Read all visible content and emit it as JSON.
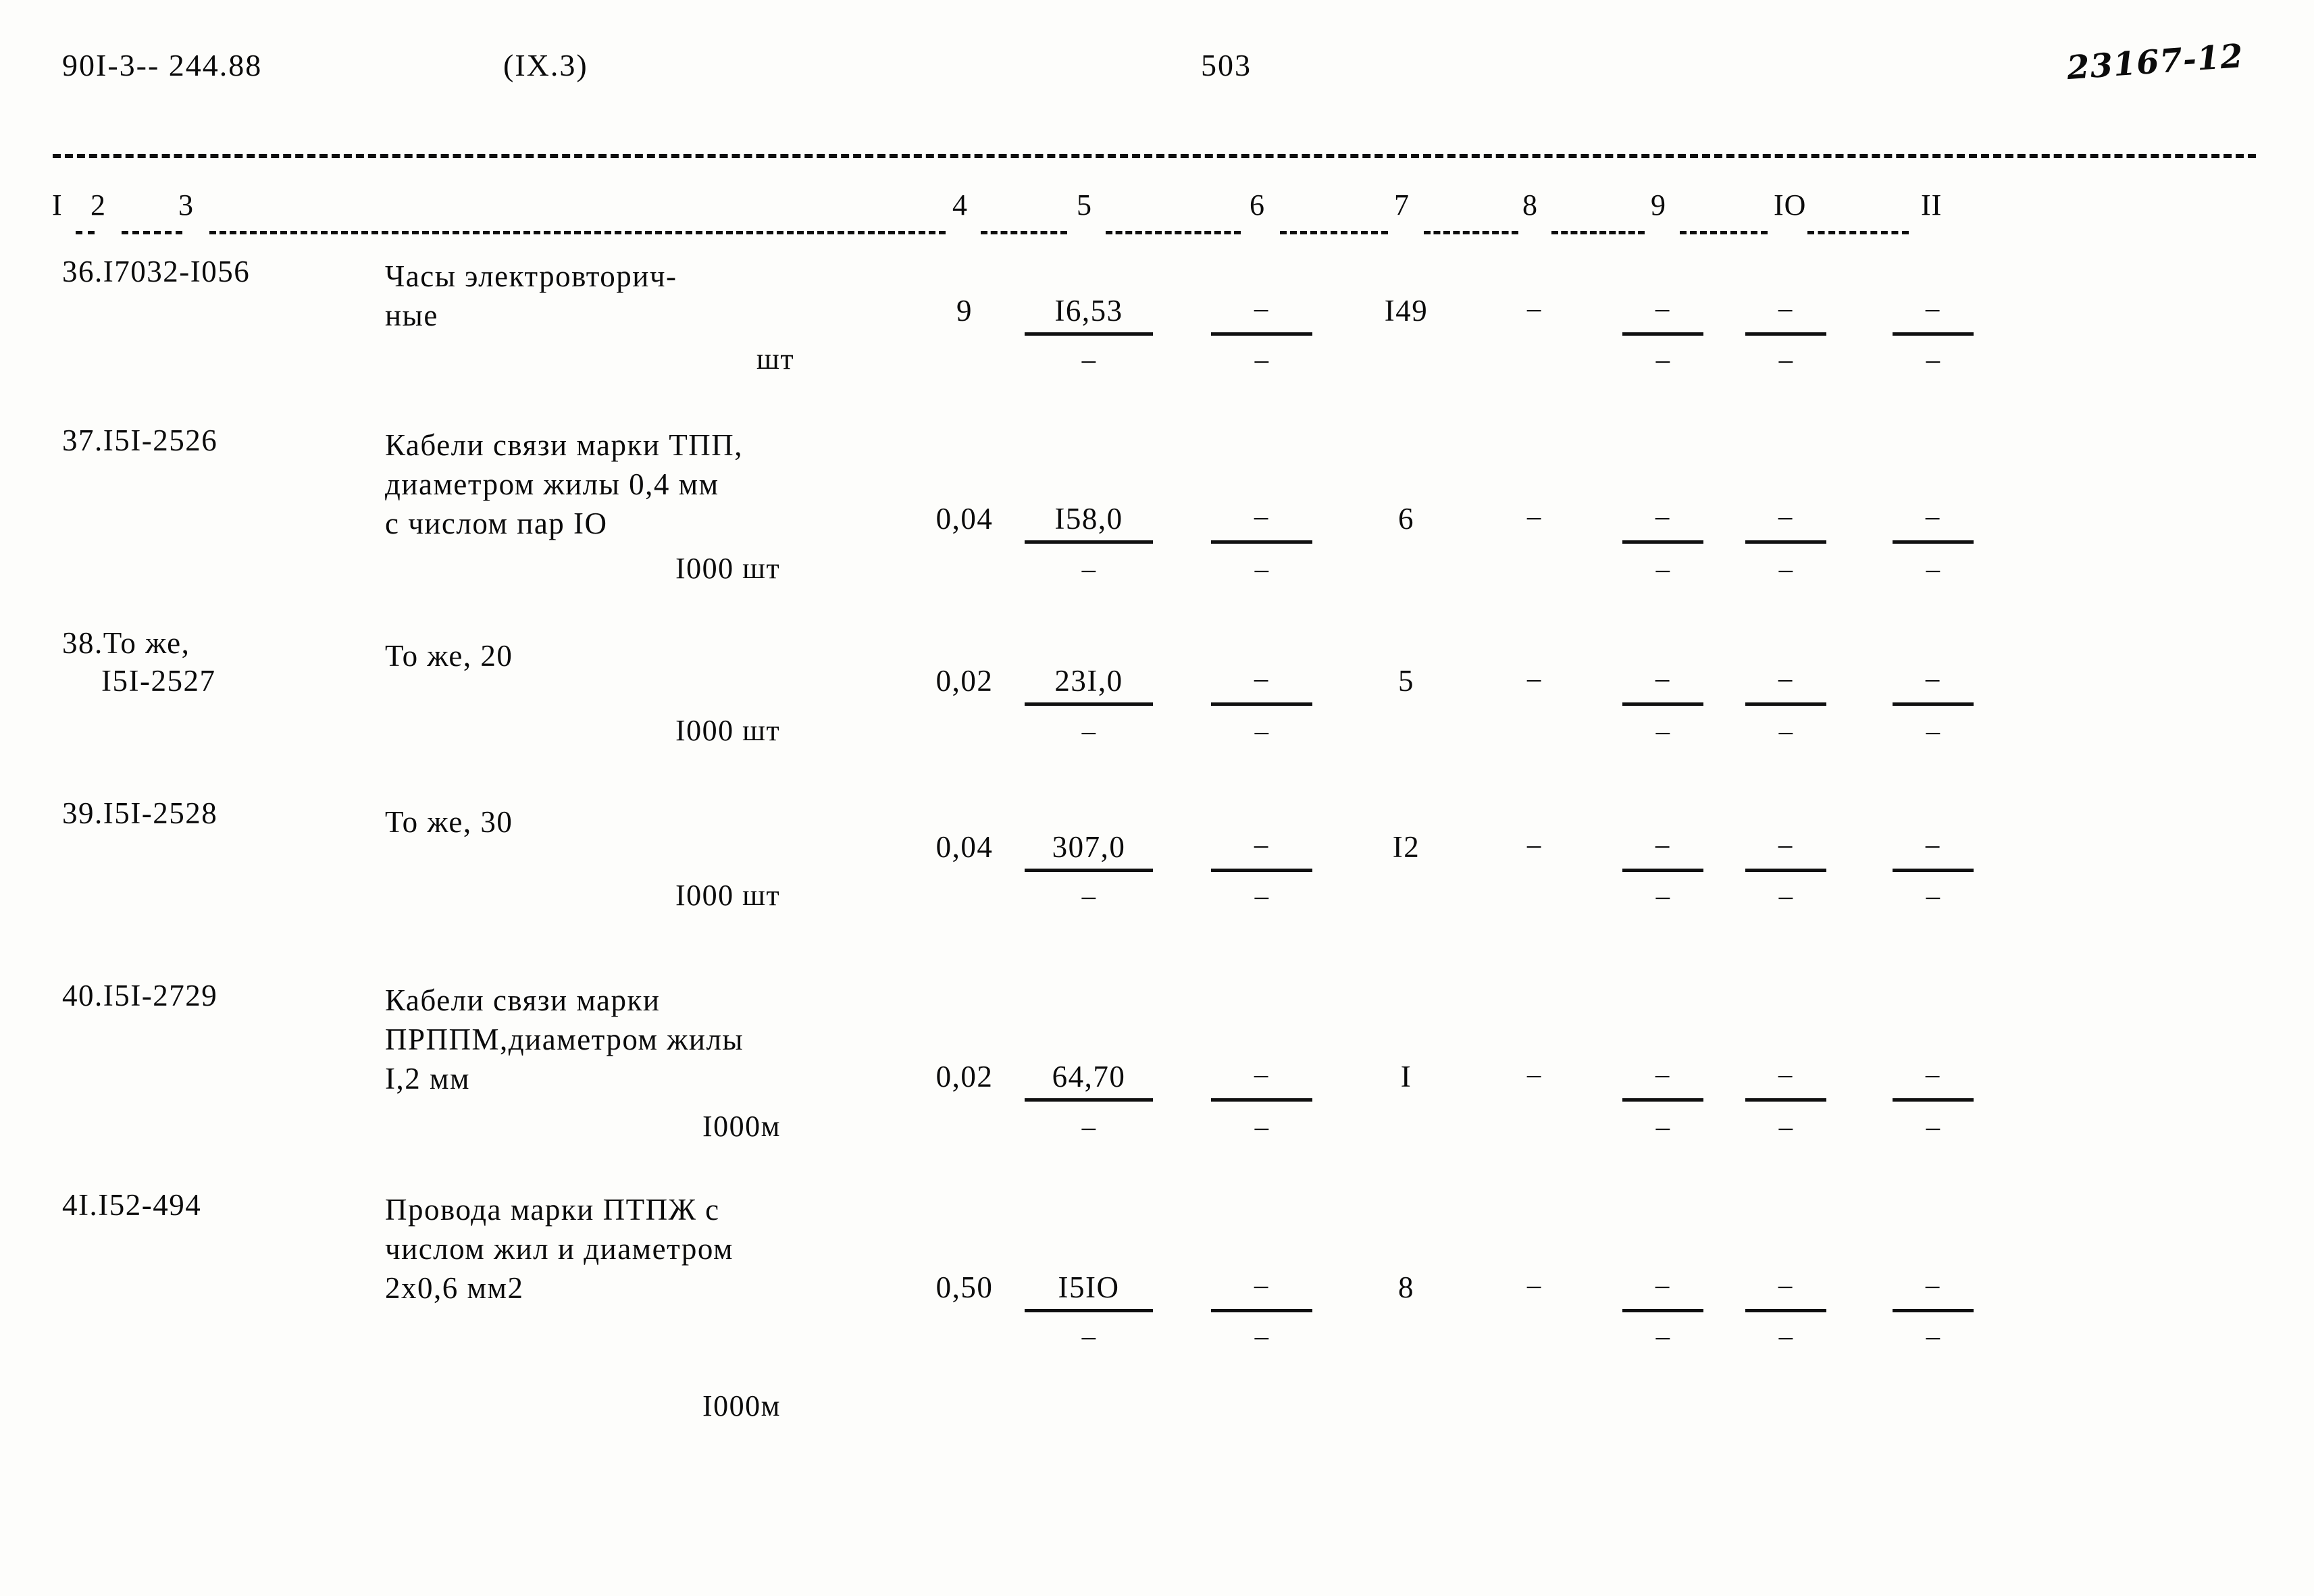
{
  "header": {
    "doc_code": "90I-3-- 244.88",
    "section": "(IX.3)",
    "page_number": "503",
    "hand_note": "23167-12"
  },
  "table": {
    "column_headers": [
      "I",
      "2",
      "3",
      "4",
      "5",
      "6",
      "7",
      "8",
      "9",
      "IO",
      "II"
    ],
    "rows": [
      {
        "code": "36.I7032-I056",
        "code2": "",
        "desc": "Часы электровторич-\nные",
        "unit": "шт",
        "c4": "9",
        "c5": "I6,53",
        "c6": "−",
        "c7": "I49",
        "c8": "−",
        "c9": "−",
        "c10": "−",
        "c11": "−",
        "s5": "−",
        "s6": "−",
        "s9": "−",
        "s10": "−",
        "s11": "−"
      },
      {
        "code": "37.I5I-2526",
        "code2": "",
        "desc": "Кабели связи марки ТПП,\nдиаметром жилы 0,4 мм\nс числом пар IO",
        "unit": "I000 шт",
        "c4": "0,04",
        "c5": "I58,0",
        "c6": "−",
        "c7": "6",
        "c8": "−",
        "c9": "−",
        "c10": "−",
        "c11": "−",
        "s5": "−",
        "s6": "−",
        "s9": "−",
        "s10": "−",
        "s11": "−"
      },
      {
        "code": "38.То же,",
        "code2": "I5I-2527",
        "desc": "То же, 20",
        "unit": "I000 шт",
        "c4": "0,02",
        "c5": "23I,0",
        "c6": "−",
        "c7": "5",
        "c8": "−",
        "c9": "−",
        "c10": "−",
        "c11": "−",
        "s5": "−",
        "s6": "−",
        "s9": "−",
        "s10": "−",
        "s11": "−"
      },
      {
        "code": "39.I5I-2528",
        "code2": "",
        "desc": "То же, 30",
        "unit": "I000 шт",
        "c4": "0,04",
        "c5": "307,0",
        "c6": "−",
        "c7": "I2",
        "c8": "−",
        "c9": "−",
        "c10": "−",
        "c11": "−",
        "s5": "−",
        "s6": "−",
        "s9": "−",
        "s10": "−",
        "s11": "−"
      },
      {
        "code": "40.I5I-2729",
        "code2": "",
        "desc": "Кабели связи марки\nПРППМ,диаметром жилы\nI,2 мм",
        "unit": "I000м",
        "c4": "0,02",
        "c5": "64,70",
        "c6": "−",
        "c7": "I",
        "c8": "−",
        "c9": "−",
        "c10": "−",
        "c11": "−",
        "s5": "−",
        "s6": "−",
        "s9": "−",
        "s10": "−",
        "s11": "−"
      },
      {
        "code": "4I.I52-494",
        "code2": "",
        "desc": "Провода марки ПТПЖ с\nчислом жил и диаметром\n2х0,6 мм2",
        "unit": "I000м",
        "c4": "0,50",
        "c5": "I5IO",
        "c6": "−",
        "c7": "8",
        "c8": "−",
        "c9": "−",
        "c10": "−",
        "c11": "−",
        "s5": "−",
        "s6": "−",
        "s9": "−",
        "s10": "−",
        "s11": "−"
      }
    ]
  }
}
